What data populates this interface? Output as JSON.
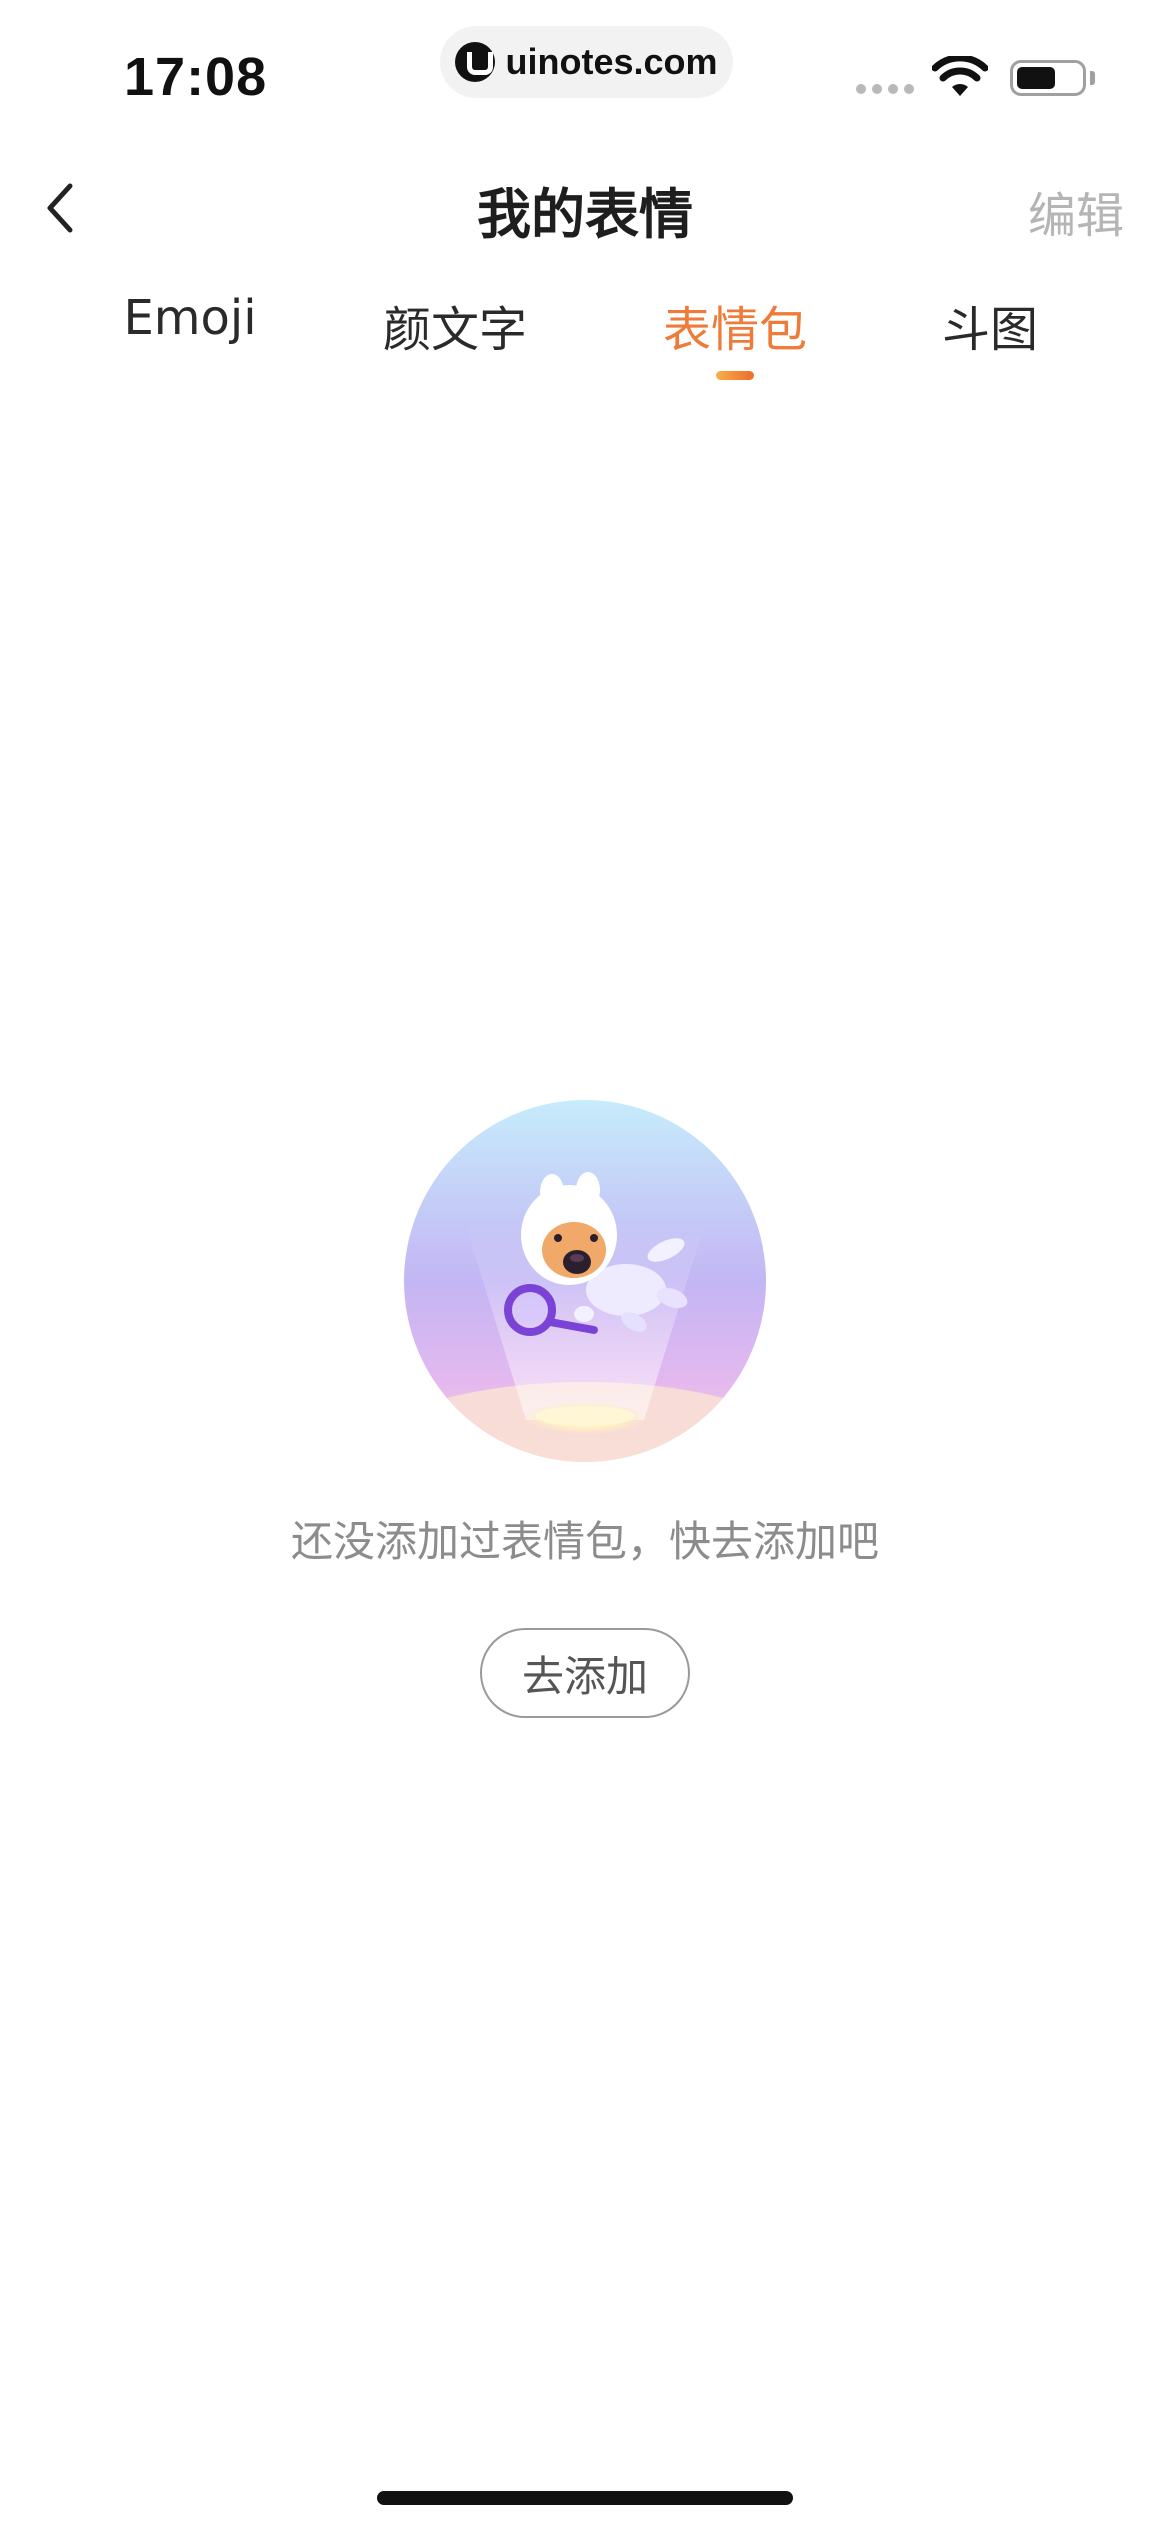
{
  "status_bar": {
    "time": "17:08",
    "url": "uinotes.com",
    "icons": [
      "signal-icon",
      "wifi-icon",
      "battery-icon"
    ]
  },
  "nav": {
    "back_icon": "chevron-left-icon",
    "title": "我的表情",
    "edit_label": "编辑"
  },
  "tabs": [
    {
      "label": "Emoji",
      "active": false
    },
    {
      "label": "颜文字",
      "active": false
    },
    {
      "label": "表情包",
      "active": true
    },
    {
      "label": "斗图",
      "active": false
    }
  ],
  "empty_state": {
    "illustration": "astronaut-dog-with-magnifier-illustration",
    "message": "还没添加过表情包，快去添加吧",
    "button_label": "去添加"
  },
  "colors": {
    "accent": "#ef7b3a",
    "title": "#1e1e1e",
    "muted": "#8c8c8c",
    "edit": "#b5b5b5"
  }
}
